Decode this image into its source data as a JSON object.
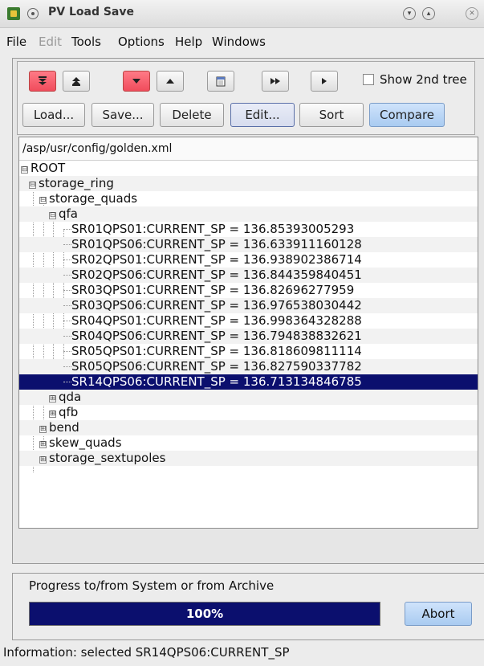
{
  "window": {
    "title": "PV Load Save"
  },
  "menu": [
    "File",
    "Edit",
    "Tools",
    "Options",
    "Help",
    "Windows"
  ],
  "toolbar": {
    "icons": [
      "collapse-all-icon",
      "expand-all-icon",
      "collapse-icon",
      "expand-icon",
      "calendar-icon",
      "fast-forward-icon",
      "play-icon"
    ],
    "show_2nd_tree_label": "Show 2nd tree",
    "show_2nd_tree_checked": false,
    "buttons": [
      "Load...",
      "Save...",
      "Delete",
      "Edit...",
      "Sort",
      "Compare"
    ]
  },
  "colors": {
    "selection": "#0b0f6e",
    "accent_button": "#a9cbf1",
    "red_button": "#f04c5c"
  },
  "tree": {
    "path": "/asp/usr/config/golden.xml",
    "nodes": [
      {
        "label": "ROOT",
        "expander": "⊟"
      },
      {
        "label": "storage_ring",
        "expander": "⊟"
      },
      {
        "label": "storage_quads",
        "expander": "⊟"
      },
      {
        "label": "qfa",
        "expander": "⊟"
      },
      {
        "label": "SR01QPS01:CURRENT_SP = 136.85393005293"
      },
      {
        "label": "SR01QPS06:CURRENT_SP = 136.633911160128"
      },
      {
        "label": "SR02QPS01:CURRENT_SP = 136.938902386714"
      },
      {
        "label": "SR02QPS06:CURRENT_SP = 136.844359840451"
      },
      {
        "label": "SR03QPS01:CURRENT_SP = 136.82696277959"
      },
      {
        "label": "SR03QPS06:CURRENT_SP = 136.976538030442"
      },
      {
        "label": "SR04QPS01:CURRENT_SP = 136.998364328288"
      },
      {
        "label": "SR04QPS06:CURRENT_SP = 136.794838832621"
      },
      {
        "label": "SR05QPS01:CURRENT_SP = 136.818609811114"
      },
      {
        "label": "SR05QPS06:CURRENT_SP = 136.827590337782"
      },
      {
        "label": "SR14QPS06:CURRENT_SP = 136.713134846785"
      },
      {
        "label": "qda",
        "expander": "⊞"
      },
      {
        "label": "qfb",
        "expander": "⊞"
      },
      {
        "label": "bend",
        "expander": "⊞"
      },
      {
        "label": "skew_quads",
        "expander": "⊞"
      },
      {
        "label": "storage_sextupoles",
        "expander": "⊞"
      }
    ]
  },
  "progress": {
    "label": "Progress to/from System or from Archive",
    "value": 1.0,
    "text": "100%",
    "abort_label": "Abort"
  },
  "status": {
    "text": "Information: selected SR14QPS06:CURRENT_SP"
  }
}
